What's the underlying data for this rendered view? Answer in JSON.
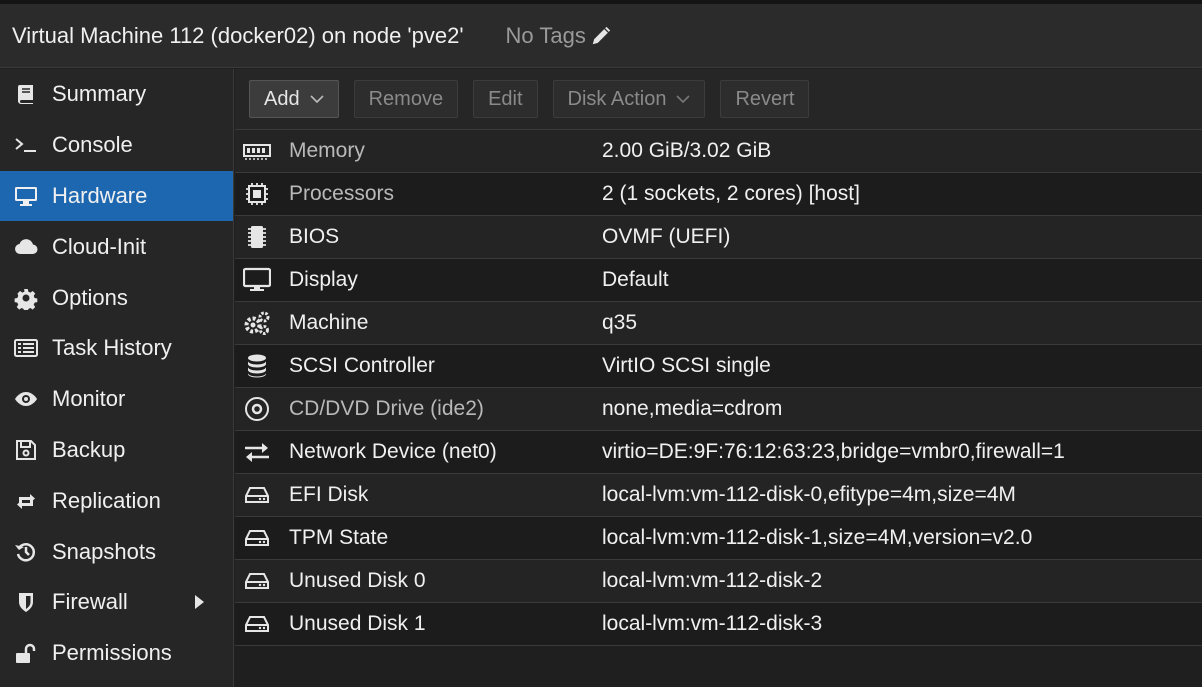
{
  "header": {
    "title": "Virtual Machine 112 (docker02) on node 'pve2'",
    "tags_label": "No Tags"
  },
  "sidebar": {
    "items": [
      {
        "label": "Summary",
        "icon": "book-icon"
      },
      {
        "label": "Console",
        "icon": "terminal-icon"
      },
      {
        "label": "Hardware",
        "icon": "monitor-icon",
        "active": true
      },
      {
        "label": "Cloud-Init",
        "icon": "cloud-icon"
      },
      {
        "label": "Options",
        "icon": "gear-icon"
      },
      {
        "label": "Task History",
        "icon": "list-icon"
      },
      {
        "label": "Monitor",
        "icon": "eye-icon"
      },
      {
        "label": "Backup",
        "icon": "floppy-icon"
      },
      {
        "label": "Replication",
        "icon": "retweet-icon"
      },
      {
        "label": "Snapshots",
        "icon": "history-icon"
      },
      {
        "label": "Firewall",
        "icon": "shield-icon"
      },
      {
        "label": "Permissions",
        "icon": "unlock-icon"
      }
    ]
  },
  "toolbar": {
    "add_label": "Add",
    "remove_label": "Remove",
    "edit_label": "Edit",
    "disk_action_label": "Disk Action",
    "revert_label": "Revert"
  },
  "hardware": {
    "rows": [
      {
        "name": "Memory",
        "value": "2.00 GiB/3.02 GiB",
        "icon": "memory-icon"
      },
      {
        "name": "Processors",
        "value": "2 (1 sockets, 2 cores) [host]",
        "icon": "cpu-icon"
      },
      {
        "name": "BIOS",
        "value": "OVMF (UEFI)",
        "icon": "microchip-icon"
      },
      {
        "name": "Display",
        "value": "Default",
        "icon": "desktop-icon"
      },
      {
        "name": "Machine",
        "value": "q35",
        "icon": "cogs-icon"
      },
      {
        "name": "SCSI Controller",
        "value": "VirtIO SCSI single",
        "icon": "database-icon"
      },
      {
        "name": "CD/DVD Drive (ide2)",
        "value": "none,media=cdrom",
        "icon": "cdrom-icon"
      },
      {
        "name": "Network Device (net0)",
        "value": "virtio=DE:9F:76:12:63:23,bridge=vmbr0,firewall=1",
        "icon": "exchange-icon"
      },
      {
        "name": "EFI Disk",
        "value": "local-lvm:vm-112-disk-0,efitype=4m,size=4M",
        "icon": "hdd-icon"
      },
      {
        "name": "TPM State",
        "value": "local-lvm:vm-112-disk-1,size=4M,version=v2.0",
        "icon": "hdd-icon"
      },
      {
        "name": "Unused Disk 0",
        "value": "local-lvm:vm-112-disk-2",
        "icon": "hdd-icon"
      },
      {
        "name": "Unused Disk 1",
        "value": "local-lvm:vm-112-disk-3",
        "icon": "hdd-icon"
      }
    ]
  }
}
